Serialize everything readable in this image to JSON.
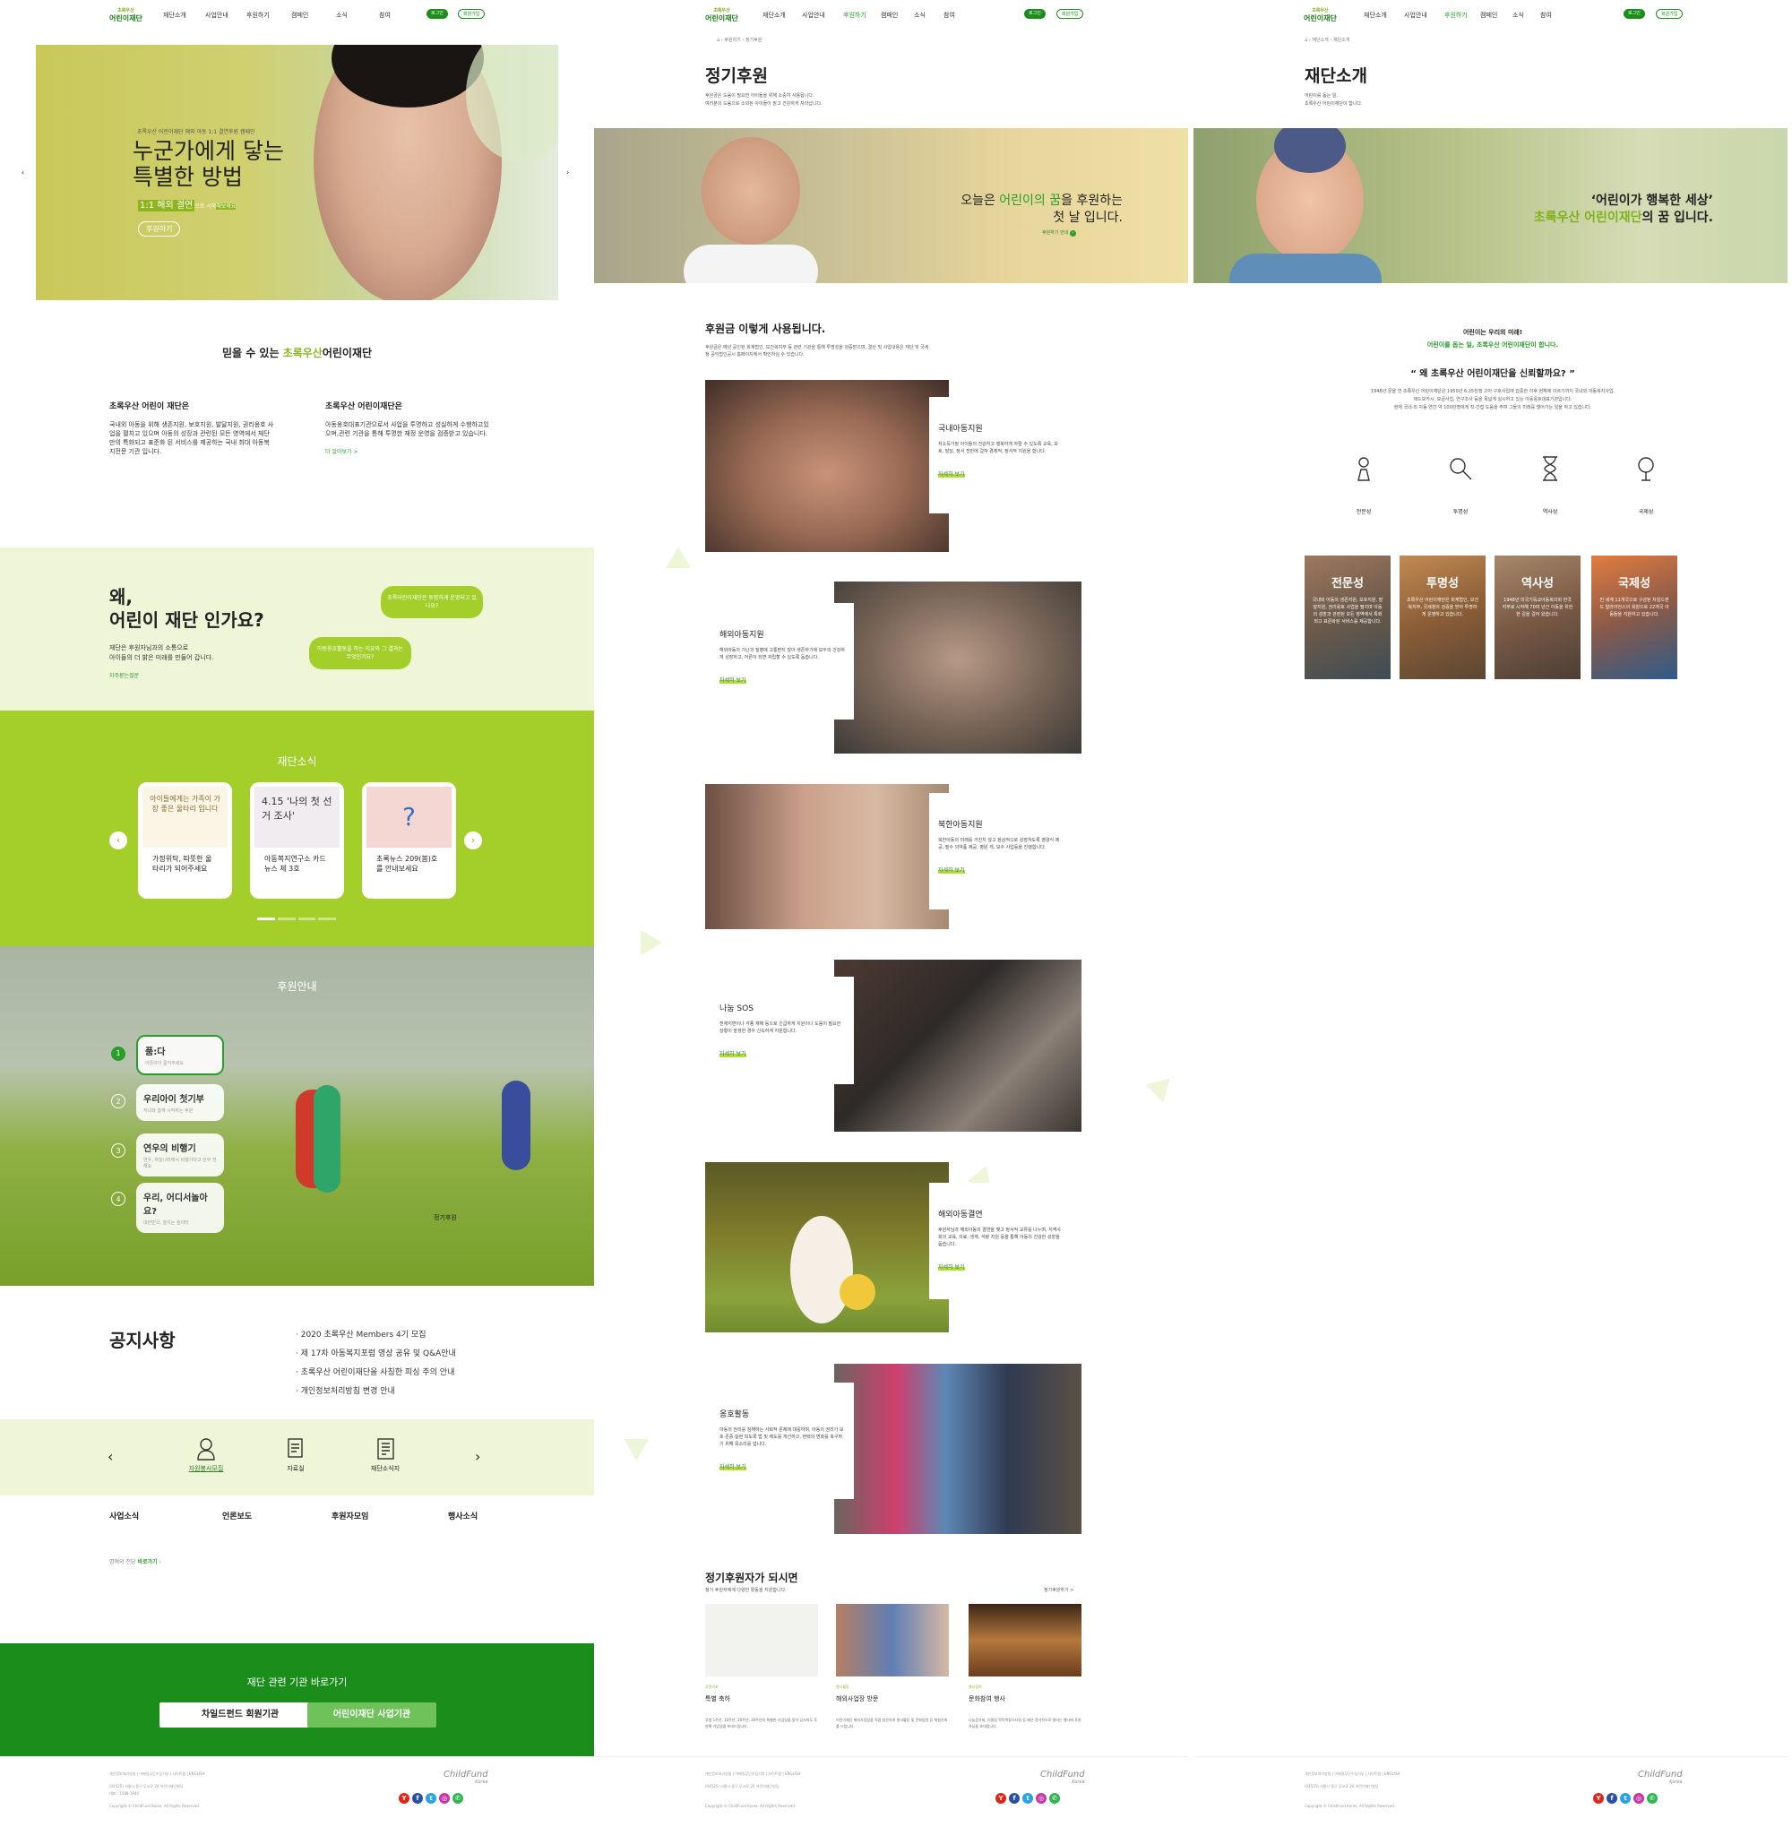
{
  "nav": {
    "logo": "어린이재단",
    "logo_top": "초록우산",
    "items": [
      "재단소개",
      "사업안내",
      "후원하기",
      "캠페인",
      "소식",
      "참여"
    ],
    "login": "로그인",
    "join": "회원가입"
  },
  "col1": {
    "hero": {
      "small": "초록우산 어린이재단 해외 아동 1:1 결연후원 캠페인",
      "title1": "누군가에게 닿는",
      "title2": "특별한 방법",
      "sub_a": "1:1 해외 결연",
      "sub_b": "으로 시작",
      "sub_c": "해보세요",
      "button": "후원하기"
    },
    "trust": {
      "prefix": "믿을 수 있는 ",
      "accent": "초록우산",
      "suffix": "어린이재단"
    },
    "about": {
      "h1": "초록우산 어린이 재단은",
      "p1": "국내외 아동을 위해 생존지원, 보호지원, 발달지원, 권리옹호 사업을 펼치고 있으며 아동의 성장과 관련된 모든 영역에서 재단만의 특화되고 표준화 된 서비스를 제공하는 국내 최대 아동복지전문 기관 입니다.",
      "h2": "초록우산 어린이재단은",
      "p2": "아동옹호대표기관으로서 사업을 투명하고 성실하게 수행하고있으며,관련 기관을 통해 투명한 재정 운영을 검증받고 있습니다.",
      "more": "더 알아보기 >"
    },
    "why": {
      "title1": "왜,",
      "title2": "어린이 재단 인가요?",
      "desc1": "재단은 후원자님과의 소통으로",
      "desc2": "아이들의 더 밝은 미래를 만들어 갑니다.",
      "faq": "자주묻는질문",
      "b1": "초록어린이재단은 투명하게 운영되고 있나요?",
      "b2": "아동옹호활동을 하는 이유와 그 결과는 무엇인가요?"
    },
    "news": {
      "title": "재단소식",
      "cards": [
        {
          "img": "아이들에게는 가족이 가장 좋은 울타리 입니다",
          "text": "가정위탁, 따뜻한 울타리가 되어주세요"
        },
        {
          "img": "4.15 '나의 첫 선거 조사'",
          "text": "아동복지연구소 카드뉴스 제 3호"
        },
        {
          "img": "?",
          "text": "초록뉴스 209(봄)호를 안내보세요"
        }
      ]
    },
    "support": {
      "title": "후원안내",
      "tabs": [
        {
          "t": "품:다",
          "s": "아픈아이 품어주세요"
        },
        {
          "t": "우리아이 첫기부",
          "s": "자녀와 함께 시작하는 후원"
        },
        {
          "t": "연우의 비행기",
          "s": "연우, 하늘나라에서 비행기타고 안부 전해요"
        },
        {
          "t": "우리, 어디서놀아요?",
          "s": "대한민국, 놀이는 놀이터"
        }
      ],
      "label": "정기후원"
    },
    "notice": {
      "title": "공지사항",
      "items": [
        "2020 초록우산 Members 4기 모집",
        "제 17차 아동복지포럼 영상 공유 및 Q&A안내",
        "초록우산 어린이재단을 사칭한 피싱 주의 안내",
        "개인정보처리방침 변경 안내"
      ]
    },
    "quick": {
      "items": [
        "자원봉사모집",
        "자료실",
        "재단소식지"
      ]
    },
    "cats": [
      "사업소식",
      "언론보도",
      "후원자모임",
      "행사소식"
    ],
    "honor": {
      "text": "명예의 전당",
      "link": "바로가기"
    },
    "related": {
      "title": "재단 관련 기관 바로가기",
      "btn1": "차일드펀드 회원기관",
      "btn2": "어린이재단 사업기관"
    }
  },
  "col2": {
    "breadcrumb": [
      "홈",
      "후원하기",
      "정기후원"
    ],
    "title": "정기후원",
    "desc1": "후원금은 도움이 필요한 아이들을 위해 소중히 사용됩니다.",
    "desc2": "여러분의 도움으로 소외된 아이들이 밝고 건강하게 자라납니다.",
    "hero": {
      "t1a": "오늘은 ",
      "t1b": "어린이의 꿈",
      "t1c": "을 후원하는",
      "t2": "첫 날 입니다.",
      "link": "후원하기 안내"
    },
    "usage": {
      "title": "후원금 이렇게 사용됩니다.",
      "desc": "후원금은 예년 공인된 회계법인, 보건복지부 등 관련 기관을 통해 투명성을 검증받으며, 결산 및 사업내용은 재단 및 국세청 공익법인공시 홈페이지에서 확인하실 수 있습니다."
    },
    "items": [
      {
        "t": "국내아동지원",
        "p": "저소득가정 아이들의 건강하고 행복하게 자랄 수 있도록 교육, 보호, 발달, 정서 전반에 걸쳐 경제적, 정서적 지원을 합니다.",
        "m": "자세히 보기"
      },
      {
        "t": "해외아동지원",
        "p": "해외아동의 가난과 질병에 고통받지 않아 생존하기에 모두의 건강하게 성장하고, 어른이 되면 자립할 수 있도록 돕습니다.",
        "m": "자세히 보기"
      },
      {
        "t": "북한아동지원",
        "p": "북한아동의 미래를 거진지 않고 정상적으로 성장하도록 영양식 제공, 필수 의약품 제공, 병원 개, 보수 사업등을 진행합니다.",
        "m": "자세히 보기"
      },
      {
        "t": "나눔 SOS",
        "p": "전재지변이나 각종 재해 등으로 긴급하게 지원이나 도움이 필요한 상황이 발생한 경우 신속하게 지원합니다.",
        "m": "자세히 보기"
      },
      {
        "t": "해외아동결연",
        "p": "후원자님과 해외아동의 결연을 맺고 정서적 교류를 나누며, 지역사회의 교육, 의료, 생계, 식량 지원 등을 통해 아동의 건강한 성장을 돕습니다.",
        "m": "자세히 보기"
      },
      {
        "t": "옹호활동",
        "p": "아동의 권리를 침해하는 사회적 문제에 대응하며, 아동의 권리가 보호·존중·실현 되도록 법 및 제도를 개선하고, 현택의 변화를 촉구하기 위해 목소리를 냅니다.",
        "m": "자세히 보기"
      }
    ],
    "benefit": {
      "title": "정기후원자가 되시면",
      "desc": "정기 후원자에게 다양한 활동을 지원합니다.",
      "more": "정기후원하기 >",
      "cards": [
        {
          "c": "후원리포",
          "t": "특별 축하",
          "p": "후원 1주년, 10주년, 20주년, 30주년의 특별한 기념일을 맞이 감사하도 후원해 기념일을 보내드립니다."
        },
        {
          "c": "봉사활동",
          "t": "해외사업장 방문",
          "p": "어린이재단 해외사업장을 직접 방문하여 봉사활동 및 문화탐방 등 체험기회를 드립니다."
        },
        {
          "c": "행사참여",
          "t": "문화참여 행사",
          "p": "나눔음악회, 어울림 학작복합스타일 등 매년 정기적으로 열리는 행사에 후원자님을 초대합니다."
        }
      ]
    }
  },
  "col3": {
    "breadcrumb": [
      "홈",
      "재단소개",
      "재단소개"
    ],
    "title": "재단소개",
    "desc1": "어린이를 돕는 일,",
    "desc2": "초록우산 어린이재단이 합니다.",
    "hero": {
      "t1": "‘어린이가 행복한 세상’",
      "t2a": "초록우산 어린이재단",
      "t2b": "의 꿈 입니다."
    },
    "mission": {
      "t1": "어린이는 우리의 미래!",
      "t2": "어린이를 돕는 일, 초록우산 어린이재단이 합니다.",
      "q": "“ 왜 초록우산 어린이재단을 신뢰할까요? ”",
      "p1": "1948년 문을 연 초록우산 어린이재단은 1950년 6.25전쟁 고아 구호사업에 집중한 이후 현재에 이르기까지 국내외 아동복지사업,",
      "p2": "애드보카시, 모금사업, 연구조사 등을 폭넓게 실시하고 있는 아동옹호대표기관입니다.",
      "p3": "현재 국내·외 아동 연간 약 100만명에게 직·간접 도움을 주며 그들의 미래를 열어가는 일을 하고 있습니다."
    },
    "values": [
      "전문성",
      "투명성",
      "역사성",
      "국제성"
    ],
    "cards": [
      {
        "t": "전문성",
        "p": "국내외 아동의 생존지원, 보호지원, 발달지원, 권리옹호 사업을 펼치며 아동의 성장과 관련된 모든 영역에서 특화되고 표준화된 서비스를 제공합니다."
      },
      {
        "t": "투명성",
        "p": "초록우산 어린이재단은 회계법인, 보건복지부, 국세청의 검증을 받아 투명하게 운영하고 있습니다."
      },
      {
        "t": "역사성",
        "p": "1948년 미국기독교아동복리회 한국지부로 시작해 70여 년간 아동을 위한 한 길을 걸어 왔습니다."
      },
      {
        "t": "국제성",
        "p": "전 세계 11개국으로 구성된 차일드펀드 얼라이언스의 회원으로 22개국 아동들을 지원하고 있습니다."
      }
    ]
  },
  "footer": {
    "links": [
      "개인정보처리방침",
      "이메일무단수집거부",
      "사이트맵",
      "ENGLISH"
    ],
    "addr": "(04525) 서울시 중구 무교로 20 어린이재단빌딩",
    "tel": "대표 : 1588-1940",
    "copy": "Copyright © ChildFund Korea. All Rights Reserved.",
    "brand": "ChildFund",
    "brand_sub": "Korea",
    "sns": [
      "Y",
      "f",
      "t",
      "◎",
      "✆"
    ]
  },
  "colors": {
    "green": "#1b8d1b",
    "lime": "#a4cf2b",
    "pale": "#eef6d7"
  }
}
